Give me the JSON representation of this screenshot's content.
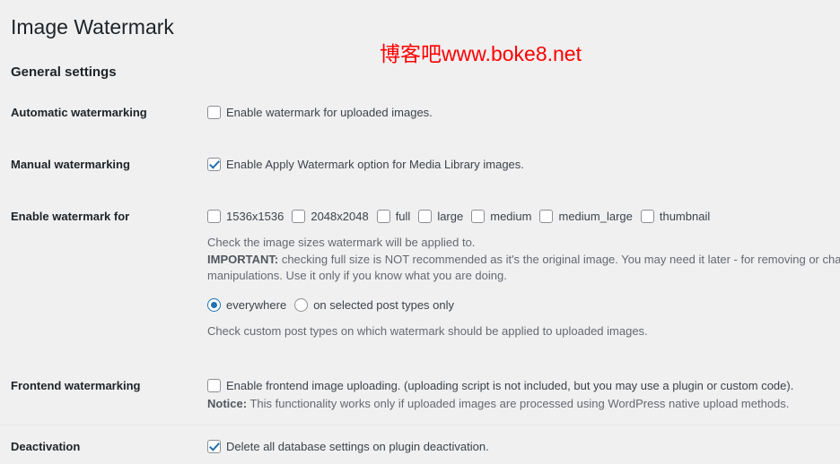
{
  "page": {
    "title": "Image Watermark",
    "watermark_overlay": "博客吧www.boke8.net",
    "watermark_color": "#ff0000",
    "accent_color": "#2271b1",
    "background_color": "#f0f0f1",
    "section_heading": "General settings"
  },
  "rows": {
    "automatic": {
      "label": "Automatic watermarking",
      "checkbox_label": "Enable watermark for uploaded images.",
      "checked": false
    },
    "manual": {
      "label": "Manual watermarking",
      "checkbox_label": "Enable Apply Watermark option for Media Library images.",
      "checked": true
    },
    "enable_for": {
      "label": "Enable watermark for",
      "sizes": [
        {
          "name": "1536x1536",
          "checked": false
        },
        {
          "name": "2048x2048",
          "checked": false
        },
        {
          "name": "full",
          "checked": false
        },
        {
          "name": "large",
          "checked": false
        },
        {
          "name": "medium",
          "checked": false
        },
        {
          "name": "medium_large",
          "checked": false
        },
        {
          "name": "thumbnail",
          "checked": false
        }
      ],
      "desc_line1": "Check the image sizes watermark will be applied to.",
      "desc_important_label": "IMPORTANT:",
      "desc_line2": " checking full size is NOT recommended as it's the original image. You may need it later - for removing or changing image",
      "desc_line3": "manipulations. Use it only if you know what you are doing.",
      "radios": [
        {
          "name": "everywhere",
          "checked": true
        },
        {
          "name": "on selected post types only",
          "checked": false
        }
      ],
      "radio_desc": "Check custom post types on which watermark should be applied to uploaded images."
    },
    "frontend": {
      "label": "Frontend watermarking",
      "checkbox_label": "Enable frontend image uploading. (uploading script is not included, but you may use a plugin or custom code).",
      "checked": false,
      "notice_label": "Notice:",
      "notice_text": " This functionality works only if uploaded images are processed using WordPress native upload methods."
    },
    "deactivation": {
      "label": "Deactivation",
      "checkbox_label": "Delete all database settings on plugin deactivation.",
      "checked": true
    }
  }
}
